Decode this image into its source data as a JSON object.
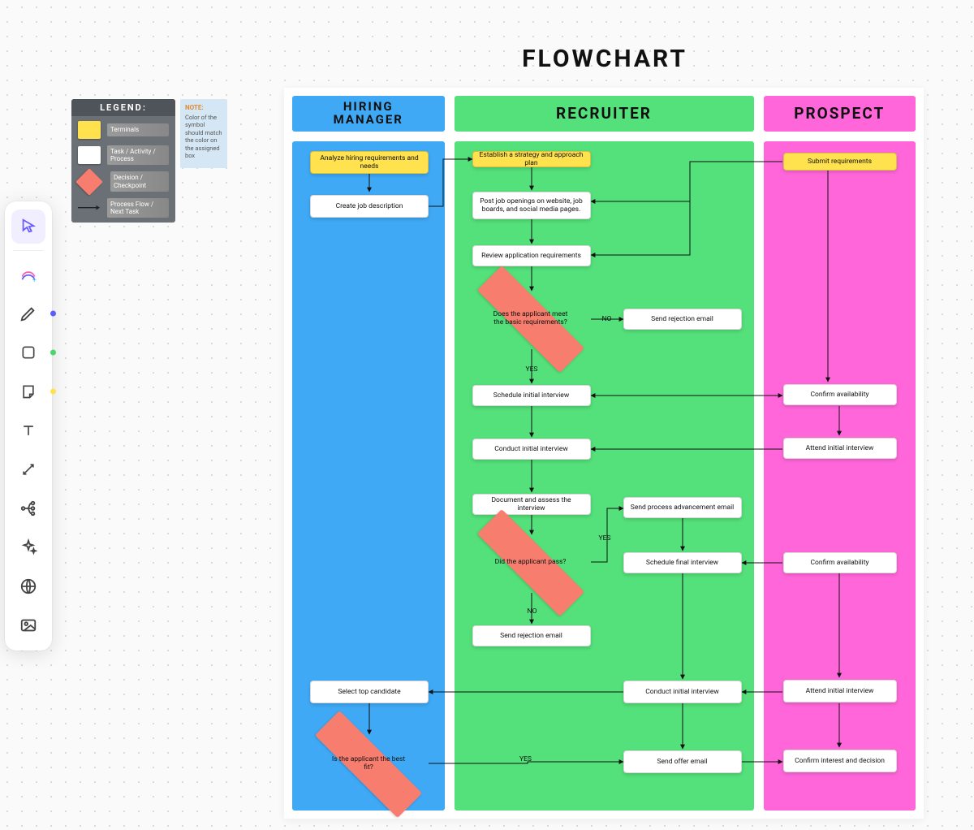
{
  "title": "FLOWCHART",
  "toolbar": {
    "items": [
      {
        "name": "cursor",
        "selected": true
      },
      {
        "name": "ai-shape"
      },
      {
        "name": "pen",
        "dot": "#5b5bff"
      },
      {
        "name": "rectangle",
        "dot": "#49d66a"
      },
      {
        "name": "sticky",
        "dot": "#ffe24d"
      },
      {
        "name": "text"
      },
      {
        "name": "connector"
      },
      {
        "name": "mindmap"
      },
      {
        "name": "sparkle"
      },
      {
        "name": "globe"
      },
      {
        "name": "image"
      }
    ]
  },
  "legend": {
    "title": "LEGEND:",
    "rows": [
      {
        "swatch": "yellow",
        "label": "Terminals"
      },
      {
        "swatch": "white",
        "label": "Task / Activity / Process"
      },
      {
        "swatch": "diamond",
        "label": "Decision / Checkpoint"
      },
      {
        "swatch": "arrow",
        "label": "Process Flow / Next Task"
      }
    ],
    "note_title": "NOTE:",
    "note_body": "Color of the symbol should match the color on the assigned box"
  },
  "lanes": {
    "hiring": "HIRING MANAGER",
    "recruiter": "RECRUITER",
    "prospect": "PROSPECT"
  },
  "nodes": {
    "hm_analyze": "Analyze hiring requirements and needs",
    "hm_jobdesc": "Create job description",
    "hm_selecttop": "Select top candidate",
    "hm_bestfit": "Is the applicant the best fit?",
    "rc_strategy": "Establish a strategy and approach plan",
    "rc_post": "Post job openings on website, job boards, and social media pages.",
    "rc_review": "Review application requirements",
    "rc_meetreq": "Does the applicant meet the basic requirements?",
    "rc_reject1": "Send rejection email",
    "rc_sched_init": "Schedule initial interview",
    "rc_conduct_init": "Conduct initial interview",
    "rc_document": "Document and assess the interview",
    "rc_pass": "Did the applicant pass?",
    "rc_advance": "Send process advancement email",
    "rc_sched_final": "Schedule final interview",
    "rc_reject2": "Send rejection email",
    "rc_conduct_final": "Conduct initial interview",
    "rc_offer": "Send offer email",
    "pr_submit": "Submit requirements",
    "pr_avail1": "Confirm availability",
    "pr_attend1": "Attend initial interview",
    "pr_avail2": "Confirm availability",
    "pr_attend2": "Attend initial interview",
    "pr_decision": "Confirm interest and decision"
  },
  "labels": {
    "yes": "YES",
    "no": "NO"
  }
}
